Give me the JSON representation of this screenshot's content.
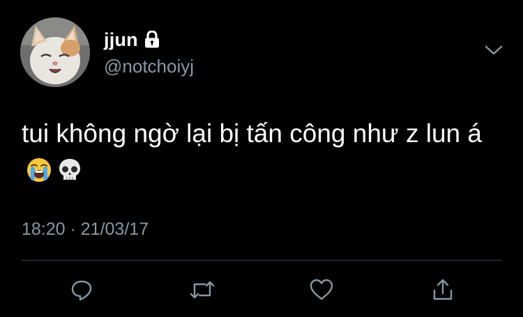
{
  "tweet": {
    "display_name": "jjun",
    "handle": "@notchoiyj",
    "text": "tui không ngờ lại bị tấn công như z lun á",
    "emojis": [
      "loudly-crying-face-icon",
      "skull-icon"
    ],
    "timestamp": "18:20 · 21/03/17",
    "protected": true
  },
  "actions": {
    "reply": "reply-icon",
    "retweet": "retweet-icon",
    "like": "heart-icon",
    "share": "share-icon"
  },
  "colors": {
    "background": "#000000",
    "text": "#ffffff",
    "secondary": "#8899a6",
    "divider": "#38444d"
  }
}
